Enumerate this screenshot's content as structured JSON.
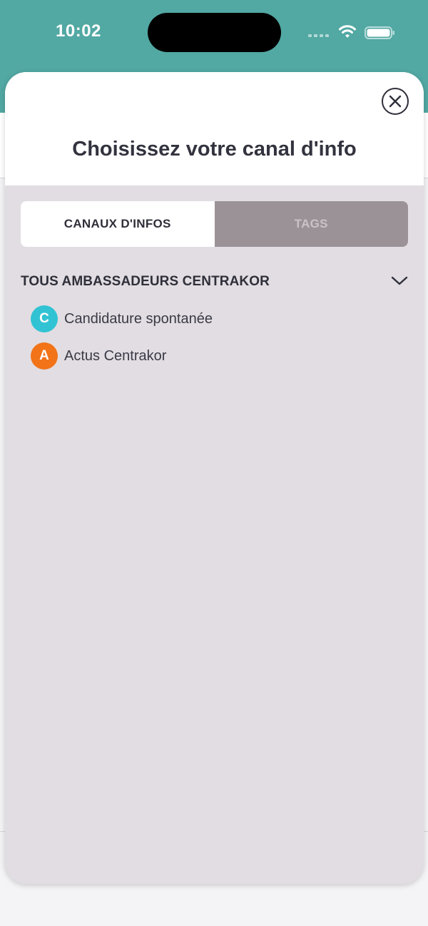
{
  "status_bar": {
    "time": "10:02"
  },
  "modal": {
    "title": "Choisissez votre canal d'info",
    "tabs": [
      {
        "label": "CANAUX D'INFOS",
        "active": true
      },
      {
        "label": "TAGS",
        "active": false
      }
    ],
    "group": {
      "title": "TOUS AMBASSADEURS CENTRAKOR",
      "expanded": true,
      "items": [
        {
          "initial": "C",
          "label": "Candidature spontanée",
          "color": "#31c3d3"
        },
        {
          "initial": "A",
          "label": "Actus Centrakor",
          "color": "#f27318"
        }
      ]
    }
  },
  "colors": {
    "header_teal": "#52a8a3",
    "sheet_background": "#e2dde2",
    "tab_inactive": "#9b9298"
  }
}
